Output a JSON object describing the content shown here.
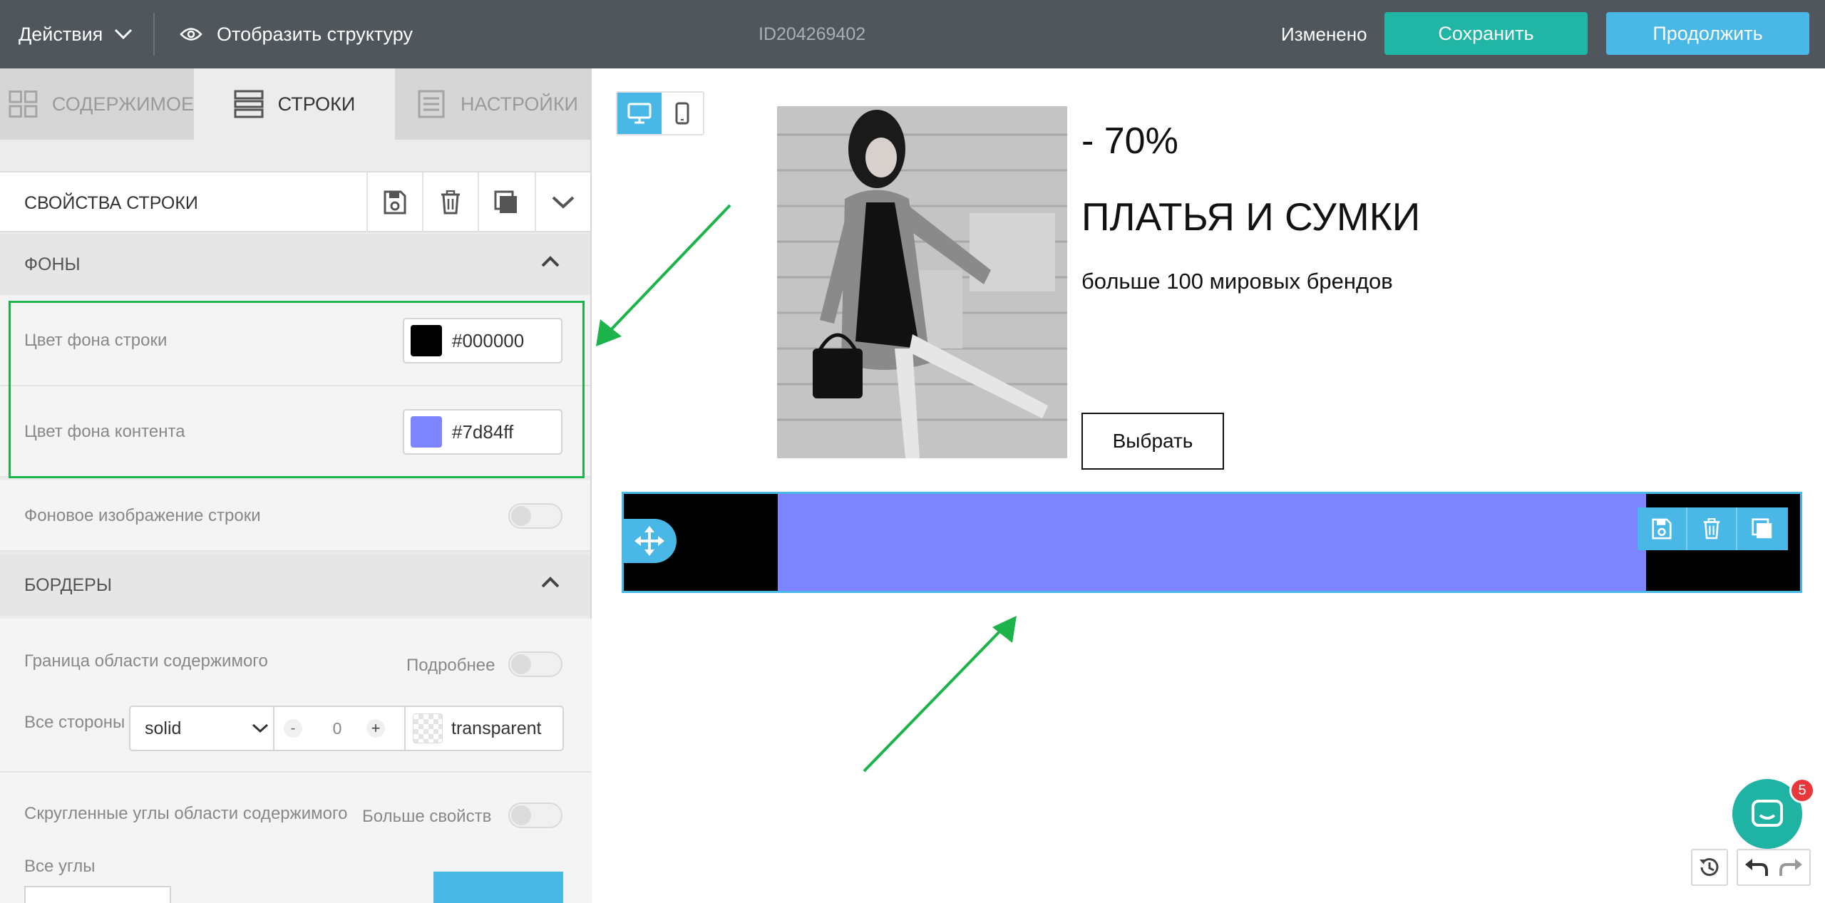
{
  "topbar": {
    "actions_label": "Действия",
    "structure_label": "Отобразить структуру",
    "doc_id": "ID204269402",
    "status": "Изменено",
    "save_label": "Сохранить",
    "continue_label": "Продолжить"
  },
  "tabs": [
    {
      "label": "СОДЕРЖИМОЕ",
      "icon": "grid-icon",
      "active": false
    },
    {
      "label": "СТРОКИ",
      "icon": "rows-icon",
      "active": true
    },
    {
      "label": "НАСТРОЙКИ",
      "icon": "settings-doc-icon",
      "active": false
    }
  ],
  "row_properties": {
    "title": "СВОЙСТВА СТРОКИ",
    "tools": [
      "save-icon",
      "trash-icon",
      "duplicate-icon",
      "chevron-down-icon"
    ]
  },
  "backgrounds": {
    "section_label": "ФОНЫ",
    "row_bg_label": "Цвет фона строки",
    "row_bg_value": "#000000",
    "content_bg_label": "Цвет фона контента",
    "content_bg_value": "#7d84ff",
    "row_image_label": "Фоновое изображение строки"
  },
  "borders": {
    "section_label": "БОРДЕРЫ",
    "content_border_label": "Граница области содержимого",
    "more_label": "Подробнее",
    "all_sides_label": "Все стороны",
    "style_value": "solid",
    "minus": "-",
    "width_value": "0",
    "plus": "+",
    "color_value": "transparent",
    "rounded_label": "Скругленные углы области содержимого",
    "more_props_label": "Больше свойств",
    "all_corners_label": "Все углы"
  },
  "canvas": {
    "discount": "- 70%",
    "heading": "ПЛАТЬЯ И СУМКИ",
    "subheading": "больше 100 мировых брендов",
    "button_label": "Выбрать",
    "row_bg_color": "#000000",
    "content_bg_color": "#7d84ff",
    "chat_badge": "5"
  },
  "colors": {
    "topbar": "#4f565c",
    "save": "#20b5a5",
    "continue": "#4ab8e6",
    "accent": "#4ab8e6",
    "annotation": "#1bb34a"
  }
}
